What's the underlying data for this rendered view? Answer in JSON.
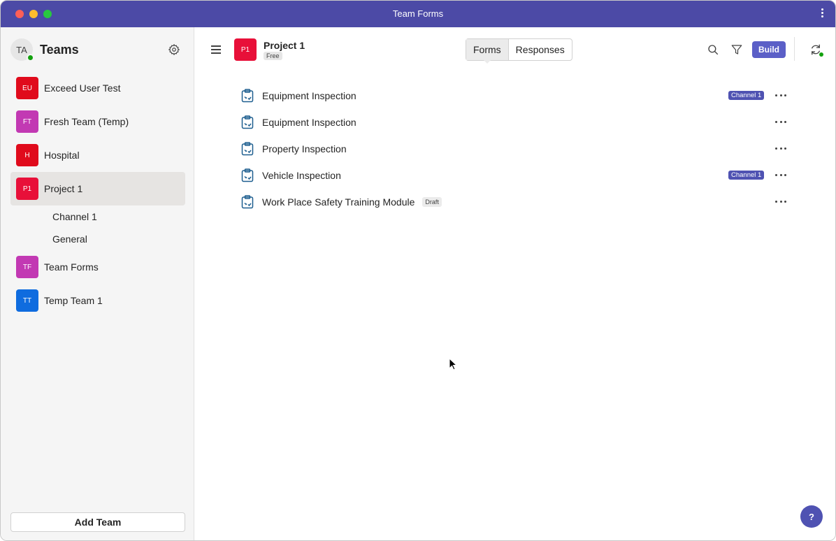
{
  "window": {
    "title": "Team Forms"
  },
  "sidebar": {
    "user_initials": "TA",
    "title": "Teams",
    "teams": [
      {
        "initials": "EU",
        "label": "Exceed User Test",
        "color": "#e00b1c"
      },
      {
        "initials": "FT",
        "label": "Fresh Team (Temp)",
        "color": "#c239b3"
      },
      {
        "initials": "H",
        "label": "Hospital",
        "color": "#e00b1c"
      },
      {
        "initials": "P1",
        "label": "Project 1",
        "color": "#e81039",
        "selected": true
      },
      {
        "initials": "TF",
        "label": "Team Forms",
        "color": "#c239b3"
      },
      {
        "initials": "TT",
        "label": "Temp Team 1",
        "color": "#0f6cdf"
      }
    ],
    "channels": [
      "Channel 1",
      "General"
    ],
    "add_team_label": "Add Team"
  },
  "header": {
    "project_initials": "P1",
    "project_name": "Project 1",
    "plan": "Free",
    "tabs": [
      "Forms",
      "Responses"
    ],
    "build_label": "Build"
  },
  "forms": [
    {
      "title": "Equipment Inspection",
      "channel": "Channel 1"
    },
    {
      "title": "Equipment Inspection"
    },
    {
      "title": "Property Inspection"
    },
    {
      "title": "Vehicle Inspection",
      "channel": "Channel 1"
    },
    {
      "title": "Work Place Safety Training Module",
      "status": "Draft"
    }
  ],
  "help_label": "?",
  "colors": {
    "accent": "#5b5fc7",
    "titlebar": "#4c4aa6",
    "presence": "#13a10e"
  }
}
